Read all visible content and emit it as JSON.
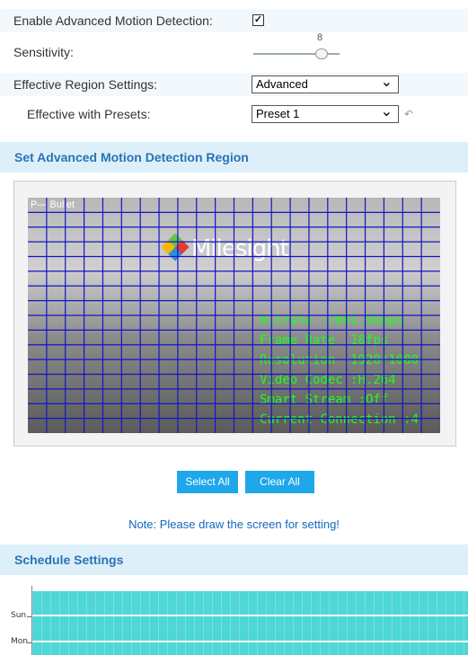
{
  "motion": {
    "enable_label": "Enable Advanced Motion Detection:",
    "enable_checked": "✓",
    "sensitivity_label": "Sensitivity:",
    "sensitivity_value": "8",
    "region_label": "Effective Region Settings:",
    "region_value": "Advanced",
    "presets_label": "Effective with Presets:",
    "presets_value": "Preset 1"
  },
  "region_section": {
    "title": "Set Advanced Motion Detection Region",
    "camera_name": "P— Bullet",
    "logo": "Milesight",
    "osd": [
      "Bitrate :7001.9kbps",
      "Frame Rate :18fps",
      "Resolution :1920*1080",
      "Video Codec :H.264",
      "Smart Stream :Off",
      "Current Connection :4"
    ],
    "select_all_label": "Select All",
    "clear_all_label": "Clear All",
    "note": "Note: Please draw the screen for setting!"
  },
  "schedule": {
    "title": "Schedule Settings",
    "days": [
      "Sun",
      "Mon"
    ]
  },
  "colors": {
    "accent": "#1ea7e9",
    "section_bg": "#ddf0fa",
    "section_text": "#2a72b6",
    "grid": "#1414c8",
    "osd": "#1bff1b",
    "schedule_fill": "#4fd6d6"
  },
  "icons": {
    "chevron": "chevron-down-icon",
    "back": "back-arrow-icon"
  }
}
